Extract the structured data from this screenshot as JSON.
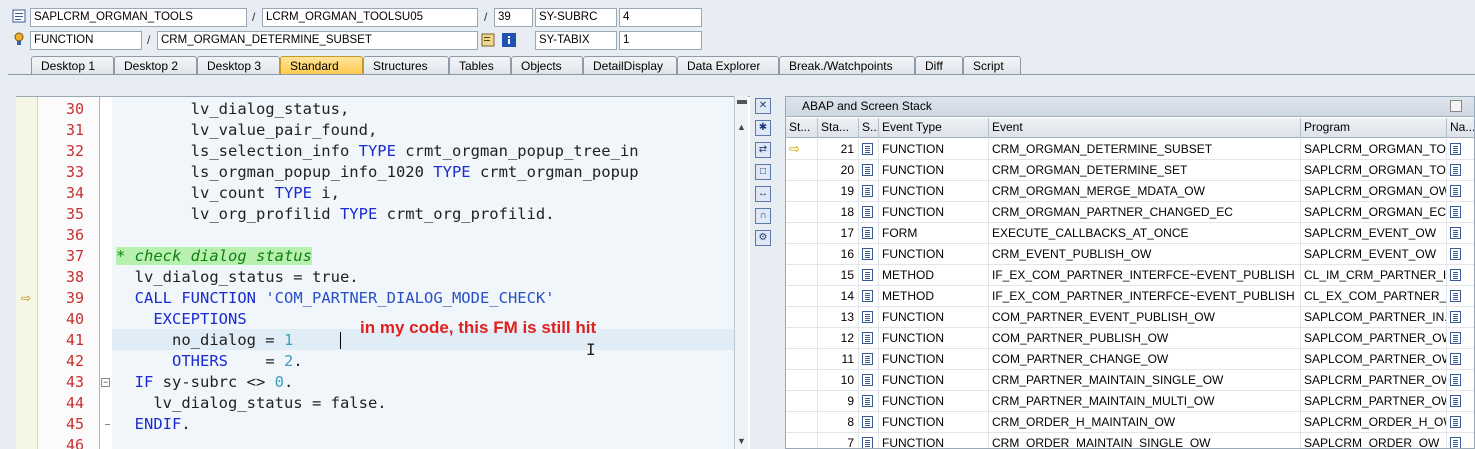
{
  "header": {
    "row1": {
      "program": "SAPLCRM_ORGMAN_TOOLS",
      "include": "LCRM_ORGMAN_TOOLSU05",
      "line": "39",
      "var_name": "SY-SUBRC",
      "var_value": "4"
    },
    "row2": {
      "type": "FUNCTION",
      "name": "CRM_ORGMAN_DETERMINE_SUBSET",
      "var_name": "SY-TABIX",
      "var_value": "1"
    },
    "separator": "/"
  },
  "tabs": [
    "Desktop 1",
    "Desktop 2",
    "Desktop 3",
    "Standard",
    "Structures",
    "Tables",
    "Objects",
    "DetailDisplay",
    "Data Explorer",
    "Break./Watchpoints",
    "Diff",
    "Script"
  ],
  "active_tab": "Standard",
  "editor": {
    "lines": [
      {
        "num": "30",
        "text": "        lv_dialog_status,"
      },
      {
        "num": "31",
        "text": "        lv_value_pair_found,"
      },
      {
        "num": "32",
        "pre": "        ls_selection_info ",
        "kw": "TYPE",
        "post": " crmt_orgman_popup_tree_in"
      },
      {
        "num": "33",
        "pre": "        ls_orgman_popup_info_1020 ",
        "kw": "TYPE",
        "post": " crmt_orgman_popup"
      },
      {
        "num": "34",
        "pre": "        lv_count ",
        "kw": "TYPE",
        "post": " i,"
      },
      {
        "num": "35",
        "pre": "        lv_org_profilid ",
        "kw": "TYPE",
        "post": " crmt_org_profilid."
      },
      {
        "num": "36",
        "text": ""
      },
      {
        "num": "37",
        "comment": "* check dialog status"
      },
      {
        "num": "38",
        "text": "  lv_dialog_status = true."
      },
      {
        "num": "39",
        "kw": "CALL FUNCTION",
        "str": "'COM_PARTNER_DIALOG_MODE_CHECK'"
      },
      {
        "num": "40",
        "kw": "EXCEPTIONS"
      },
      {
        "num": "41",
        "pre": "      no_dialog = ",
        "numv": "1"
      },
      {
        "num": "42",
        "kw": "OTHERS",
        "post": "    = ",
        "numv": "2"
      },
      {
        "num": "43",
        "kw": "IF",
        "post": " sy-subrc <> ",
        "numv": "0"
      },
      {
        "num": "44",
        "text": "    lv_dialog_status = false."
      },
      {
        "num": "45",
        "kw": "ENDIF"
      },
      {
        "num": "46",
        "text": ""
      }
    ],
    "annotation": "in my code, this FM is still hit"
  },
  "stack": {
    "title": "ABAP and Screen Stack",
    "columns": [
      "St...",
      "Sta...",
      "S...",
      "Event Type",
      "Event",
      "Program",
      "Na..."
    ],
    "rows": [
      {
        "level": "21",
        "type": "FUNCTION",
        "event": "CRM_ORGMAN_DETERMINE_SUBSET",
        "program": "SAPLCRM_ORGMAN_TO...",
        "current": true
      },
      {
        "level": "20",
        "type": "FUNCTION",
        "event": "CRM_ORGMAN_DETERMINE_SET",
        "program": "SAPLCRM_ORGMAN_TO..."
      },
      {
        "level": "19",
        "type": "FUNCTION",
        "event": "CRM_ORGMAN_MERGE_MDATA_OW",
        "program": "SAPLCRM_ORGMAN_OW"
      },
      {
        "level": "18",
        "type": "FUNCTION",
        "event": "CRM_ORGMAN_PARTNER_CHANGED_EC",
        "program": "SAPLCRM_ORGMAN_EC"
      },
      {
        "level": "17",
        "type": "FORM",
        "event": "EXECUTE_CALLBACKS_AT_ONCE",
        "program": "SAPLCRM_EVENT_OW"
      },
      {
        "level": "16",
        "type": "FUNCTION",
        "event": "CRM_EVENT_PUBLISH_OW",
        "program": "SAPLCRM_EVENT_OW"
      },
      {
        "level": "15",
        "type": "METHOD",
        "event": "IF_EX_COM_PARTNER_INTERFCE~EVENT_PUBLISH",
        "program": "CL_IM_CRM_PARTNER_I..."
      },
      {
        "level": "14",
        "type": "METHOD",
        "event": "IF_EX_COM_PARTNER_INTERFCE~EVENT_PUBLISH",
        "program": "CL_EX_COM_PARTNER_I..."
      },
      {
        "level": "13",
        "type": "FUNCTION",
        "event": "COM_PARTNER_EVENT_PUBLISH_OW",
        "program": "SAPLCOM_PARTNER_IN..."
      },
      {
        "level": "12",
        "type": "FUNCTION",
        "event": "COM_PARTNER_PUBLISH_OW",
        "program": "SAPLCOM_PARTNER_OW"
      },
      {
        "level": "11",
        "type": "FUNCTION",
        "event": "COM_PARTNER_CHANGE_OW",
        "program": "SAPLCOM_PARTNER_OW"
      },
      {
        "level": "10",
        "type": "FUNCTION",
        "event": "CRM_PARTNER_MAINTAIN_SINGLE_OW",
        "program": "SAPLCRM_PARTNER_OW"
      },
      {
        "level": "9",
        "type": "FUNCTION",
        "event": "CRM_PARTNER_MAINTAIN_MULTI_OW",
        "program": "SAPLCRM_PARTNER_OW"
      },
      {
        "level": "8",
        "type": "FUNCTION",
        "event": "CRM_ORDER_H_MAINTAIN_OW",
        "program": "SAPLCRM_ORDER_H_OW"
      },
      {
        "level": "7",
        "type": "FUNCTION",
        "event": "CRM_ORDER_MAINTAIN_SINGLE_OW",
        "program": "SAPLCRM_ORDER_OW"
      }
    ]
  },
  "colors": {
    "accent": "#ffc94d",
    "line_number": "#c83030",
    "keyword": "#1a2bd0",
    "annotation": "#e0201e"
  }
}
